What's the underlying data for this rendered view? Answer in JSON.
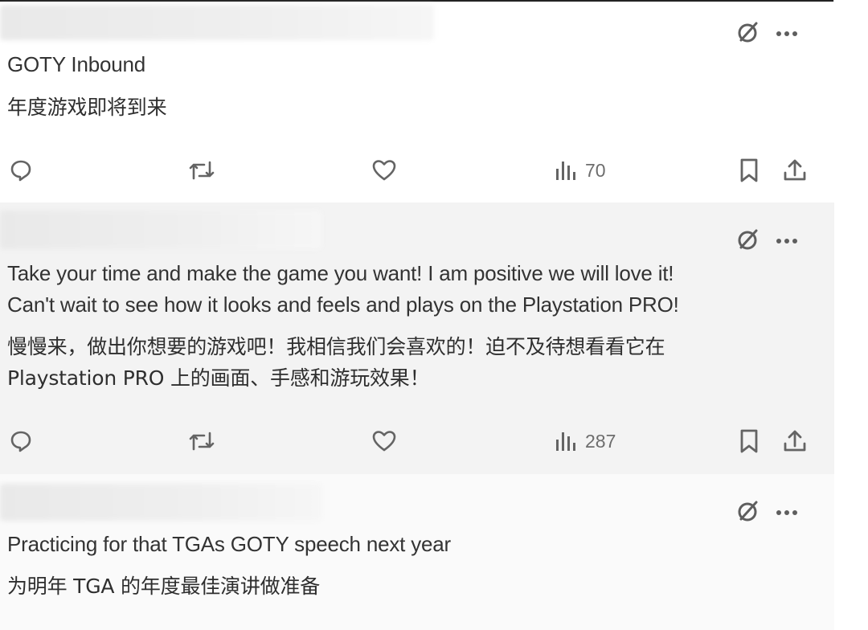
{
  "tweets": [
    {
      "text_en": "GOTY Inbound",
      "text_zh": "年度游戏即将到来",
      "views": "70",
      "icons": [
        "grok-icon",
        "more-icon",
        "reply-icon",
        "retweet-icon",
        "like-icon",
        "views-icon",
        "bookmark-icon",
        "share-icon"
      ]
    },
    {
      "text_en_line1": "Take your time and make the game you want! I am positive we will love it!",
      "text_en_line2": "Can't wait to see how it looks and feels and plays on the Playstation PRO!",
      "text_zh_line1": "慢慢来，做出你想要的游戏吧！我相信我们会喜欢的！迫不及待想看看它在",
      "text_zh_line2": "Playstation PRO 上的画面、手感和游玩效果！",
      "views": "287"
    },
    {
      "text_en": "Practicing for that TGAs GOTY speech next year",
      "text_zh": "为明年 TGA 的年度最佳演讲做准备"
    }
  ],
  "colors": {
    "icon": "#646464",
    "text": "#333333",
    "background": "#f3f3f3"
  }
}
